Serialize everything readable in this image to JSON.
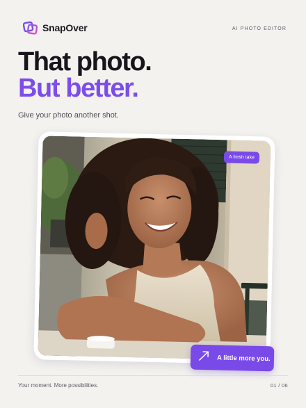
{
  "brand": {
    "name": "SnapOver",
    "logo_icon": "stacked-photos-icon",
    "accent": "#7b4dea"
  },
  "header": {
    "tagline": "AI PHOTO EDITOR"
  },
  "hero": {
    "headline_line1": "That photo.",
    "headline_line2": "But better.",
    "subline": "Give your photo another shot."
  },
  "photo": {
    "description_icon": "portrait-photo",
    "chip_top": "A fresh take",
    "chip_bottom": "A little more you.",
    "chip_bottom_icon": "arrow-up-right-icon"
  },
  "footer": {
    "caption": "Your moment. More possibilities.",
    "page_indicator": "01 / 06"
  }
}
